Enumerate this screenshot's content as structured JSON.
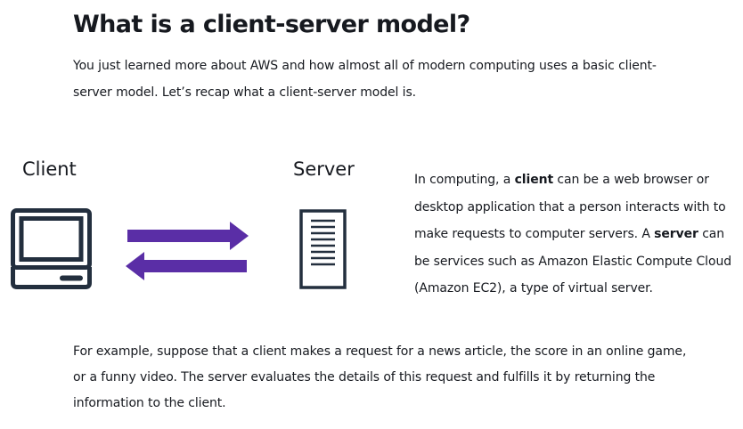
{
  "title": "What is a client-server model?",
  "intro": "You just learned more about AWS and how almost all of modern computing uses a basic client-server model. Let’s recap what a client-server model is.",
  "diagram": {
    "client_label": "Client",
    "server_label": "Server",
    "client_icon": "desktop-computer-icon",
    "server_icon": "server-tower-icon",
    "arrows_icon": "bidirectional-arrows-icon",
    "arrow_color": "#5a2ea6"
  },
  "description": {
    "part1": "In computing, a ",
    "client_term": "client",
    "part2": " can be a web browser or desktop application that a person interacts with to make requests to computer servers. A ",
    "server_term": "server",
    "part3": " can be services such as Amazon Elastic Compute Cloud (Amazon EC2), a type of virtual server."
  },
  "example": "For example, suppose that a client makes a request for a news article, the score in an online game, or a funny video. The server evaluates the details of this request and fulfills it by returning the information to the client."
}
